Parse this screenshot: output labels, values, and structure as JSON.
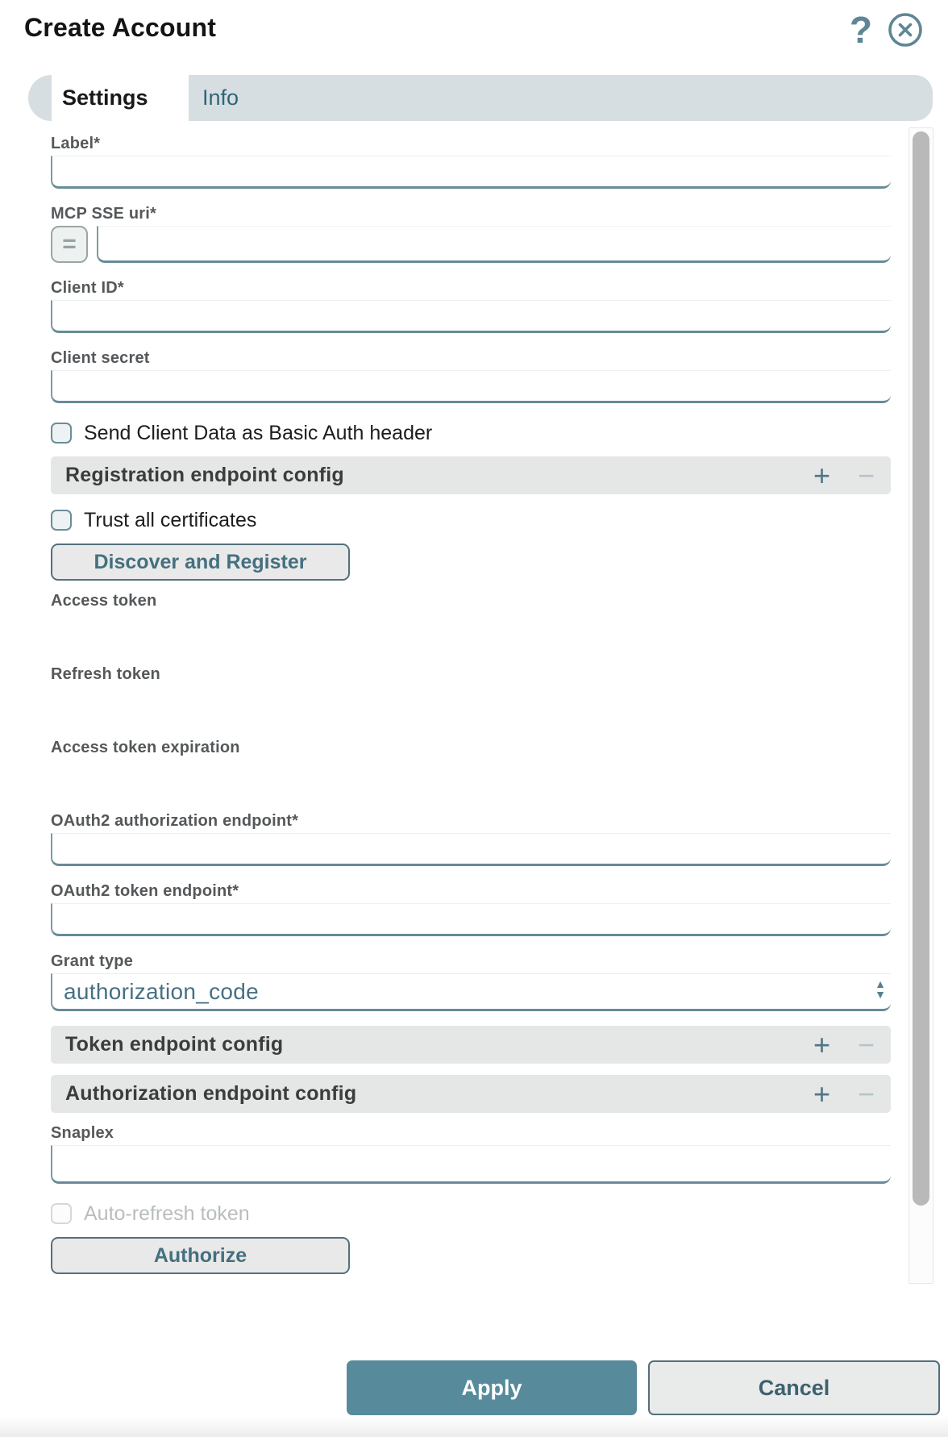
{
  "dialog": {
    "title": "Create Account"
  },
  "icons": {
    "help": "?",
    "close": "✕",
    "plus": "+",
    "minus": "−",
    "spin_up": "▲",
    "spin_down": "▼",
    "expression": "="
  },
  "tabs": [
    {
      "label": "Settings",
      "active": true
    },
    {
      "label": "Info",
      "active": false
    }
  ],
  "fields": {
    "label": {
      "label": "Label*",
      "value": ""
    },
    "mcp_sse_uri": {
      "label": "MCP SSE uri*",
      "value": ""
    },
    "client_id": {
      "label": "Client ID*",
      "value": ""
    },
    "client_secret": {
      "label": "Client secret",
      "value": ""
    },
    "access_token": {
      "label": "Access token",
      "value": ""
    },
    "refresh_token": {
      "label": "Refresh token",
      "value": ""
    },
    "access_token_expiration": {
      "label": "Access token expiration",
      "value": ""
    },
    "oauth2_authorization_endpoint": {
      "label": "OAuth2 authorization endpoint*",
      "value": ""
    },
    "oauth2_token_endpoint": {
      "label": "OAuth2 token endpoint*",
      "value": ""
    },
    "grant_type": {
      "label": "Grant type",
      "value": "authorization_code"
    },
    "snaplex": {
      "label": "Snaplex",
      "value": ""
    }
  },
  "checkboxes": {
    "send_client_data": {
      "label": "Send Client Data as Basic Auth header",
      "checked": false
    },
    "trust_all_certificates": {
      "label": "Trust all certificates",
      "checked": false
    },
    "auto_refresh_token": {
      "label": "Auto-refresh token",
      "checked": false,
      "disabled": true
    }
  },
  "sections": {
    "registration": {
      "title": "Registration endpoint config"
    },
    "token": {
      "title": "Token endpoint config"
    },
    "authorization": {
      "title": "Authorization endpoint config"
    }
  },
  "buttons": {
    "discover_and_register": "Discover and Register",
    "authorize": "Authorize",
    "apply": "Apply",
    "cancel": "Cancel"
  },
  "colors": {
    "accent_border": "#678b97",
    "accent_text": "#44707f",
    "icon_slate": "#5f8695",
    "apply_bg": "#578b9b",
    "tab_bar_bg": "#d6dee1",
    "section_bg": "#e5e6e6",
    "active_tab_bg": "#ffffff"
  }
}
